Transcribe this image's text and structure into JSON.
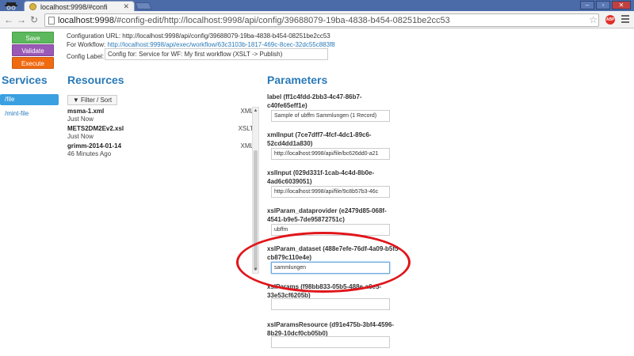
{
  "browser": {
    "tab_title": "localhost:9998/#confi",
    "url_host": "localhost:9998",
    "url_rest": "/#config-edit/http://localhost:9998/api/config/39688079-19ba-4838-b454-08251be2cc53",
    "window_buttons": [
      "–",
      "▫",
      "✕"
    ]
  },
  "actions": {
    "save": "Save",
    "validate": "Validate",
    "execute": "Execute"
  },
  "config": {
    "url_label": "Configuration URL:",
    "url_value": "http://localhost:9998/api/config/39688079-19ba-4838-b454-08251be2cc53",
    "workflow_label": "For Workflow:",
    "workflow_link": "http://localhost:9998/api/exec/workflow/63c3103b-1817-469c-8cec-32dc55c883f8",
    "config_label_label": "Config Label:",
    "config_label_value": "Config for: Service for WF: My first workflow (XSLT -> Publish)"
  },
  "sections": {
    "services": "Services",
    "resources": "Resources",
    "parameters": "Parameters"
  },
  "services": [
    {
      "label": "/file",
      "active": true
    },
    {
      "label": "/mint-file",
      "active": false
    }
  ],
  "resources": {
    "filter_button": "Filter / Sort",
    "filter_icon": "filter-icon",
    "items": [
      {
        "name": "msma-1.xml",
        "time": "Just Now",
        "type": "XML"
      },
      {
        "name": "METS2DM2Ev2.xsl",
        "time": "Just Now",
        "type": "XSLT"
      },
      {
        "name": "grimm-2014-01-14",
        "time": "46 Minutes Ago",
        "type": "XML"
      }
    ]
  },
  "parameters": [
    {
      "label": "label (ff1c4fdd-2bb3-4c47-86b7-c40fe65eff1e)",
      "value": "Sample of ubffm Sammlungen (1 Record)"
    },
    {
      "label": "xmlInput (7ce7dff7-4fcf-4dc1-89c6-52cd4dd1a830)",
      "value": "http://localhost:9998/api/file/bc626dd0-a21"
    },
    {
      "label": "xslInput (029d331f-1cab-4c4d-8b0e-4ad6c6039051)",
      "value": "http://localhost:9998/api/file/9c8b57b3-46c"
    },
    {
      "label": "xslParam_dataprovider (e2479d85-068f-4541-b9e5-7de95872751c)",
      "value": "ubffm"
    },
    {
      "label": "xslParam_dataset (488e7efe-76df-4a09-b5f5-cb879c110e4e)",
      "value": "sammlungen"
    },
    {
      "label": "xslParams (f98bb833-05b5-488e-a6e5-33e53cf6205b)",
      "value": ""
    },
    {
      "label": "xslParamsResource (d91e475b-3bf4-4596-8b29-10dcf0cb05b0)",
      "value": ""
    }
  ],
  "colors": {
    "save": "#5cb85c",
    "validate": "#9b59b6",
    "execute": "#f06a10",
    "accent": "#2a7ab8",
    "highlight": "#e0161b"
  }
}
